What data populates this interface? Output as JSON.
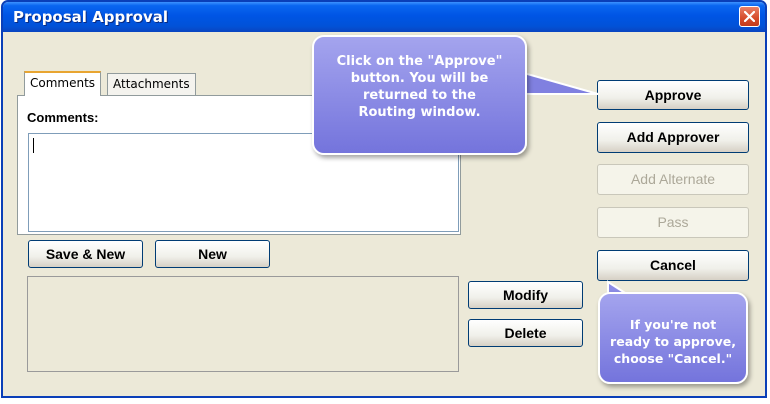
{
  "window": {
    "title": "Proposal Approval"
  },
  "tabs": [
    {
      "label": "Comments",
      "active": true
    },
    {
      "label": "Attachments",
      "active": false
    }
  ],
  "comments": {
    "label": "Comments:",
    "value": ""
  },
  "buttons": {
    "save_new": "Save & New",
    "new": "New",
    "modify": "Modify",
    "delete": "Delete",
    "approve": "Approve",
    "add_approver": "Add Approver",
    "add_alternate": "Add Alternate",
    "pass": "Pass",
    "cancel": "Cancel"
  },
  "callouts": {
    "approve_lines": [
      "Click on the \"Approve\"",
      "button.  You will be",
      "returned to the",
      "Routing window."
    ],
    "cancel_lines": [
      "If you're not",
      "ready to approve,",
      "choose \"Cancel.\""
    ]
  },
  "colors": {
    "titlebar": "#0055e5",
    "window_bg": "#ece9d8",
    "callout": "#8c8ce6",
    "close_button": "#d64b2a"
  },
  "icons": {
    "close": "close-icon"
  }
}
